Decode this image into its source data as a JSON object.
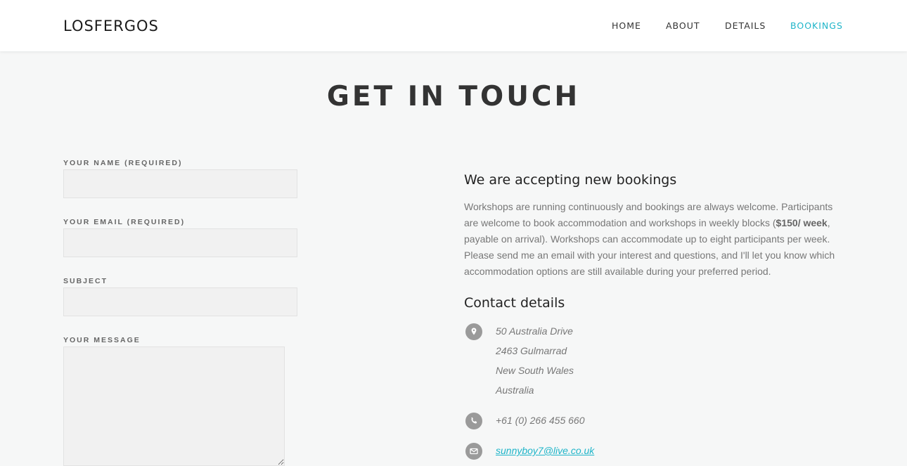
{
  "header": {
    "logo": "LOSFERGOS",
    "nav": [
      {
        "label": "HOME",
        "active": false
      },
      {
        "label": "ABOUT",
        "active": false
      },
      {
        "label": "DETAILS",
        "active": false
      },
      {
        "label": "BOOKINGS",
        "active": true
      }
    ]
  },
  "page_title": "GET IN TOUCH",
  "form": {
    "name_label": "YOUR NAME (REQUIRED)",
    "name_value": "",
    "email_label": "YOUR EMAIL (REQUIRED)",
    "email_value": "",
    "subject_label": "SUBJECT",
    "subject_value": "",
    "message_label": "YOUR MESSAGE",
    "message_value": ""
  },
  "info": {
    "heading": "We are accepting new bookings",
    "para_before": "Workshops are running continuously and bookings are always welcome. Participants are welcome to book accommodation and workshops in weekly blocks (",
    "para_bold": "$150/ week",
    "para_after": ", payable on arrival). Workshops can accommodate up to eight participants per week. Please send me an email with your interest and questions, and I'll let you know which accommodation options are still available during your preferred period."
  },
  "contact": {
    "heading": "Contact details",
    "address": [
      "50 Australia Drive",
      "2463 Gulmarrad",
      "New South Wales",
      "Australia"
    ],
    "phone": "+61 (0) 266 455 660",
    "email": "sunnyboy7@live.co.uk"
  },
  "colors": {
    "accent": "#1fb5c9",
    "background": "#f6f7f7",
    "icon_bg": "#9a9a9a"
  },
  "icons": {
    "address": "map-pin-icon",
    "phone": "phone-icon",
    "email": "envelope-icon"
  }
}
